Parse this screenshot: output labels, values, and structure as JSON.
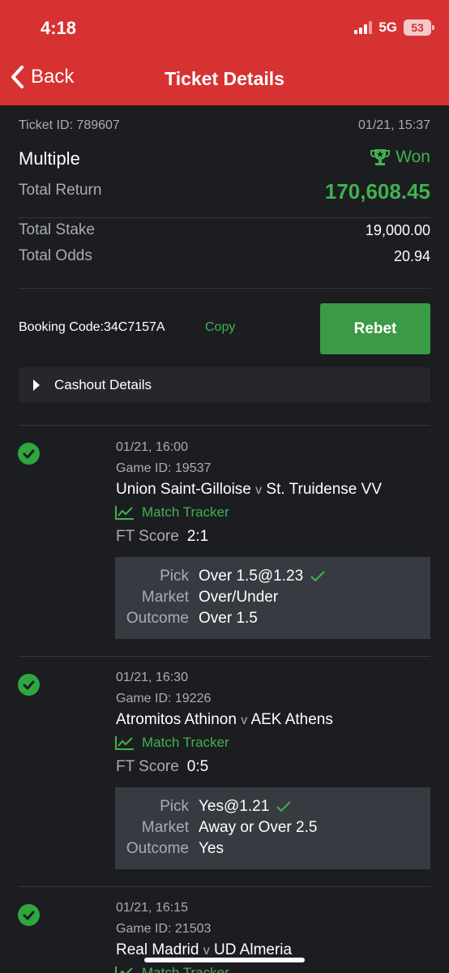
{
  "status_bar": {
    "time": "4:18",
    "network": "5G",
    "battery": "53"
  },
  "nav": {
    "back_label": "Back",
    "title": "Ticket Details"
  },
  "ticket": {
    "id_text": "Ticket ID: 789607",
    "datetime": "01/21, 15:37",
    "type": "Multiple",
    "status": "Won",
    "total_return_label": "Total Return",
    "total_return": "170,608.45",
    "total_stake_label": "Total Stake",
    "total_stake": "19,000.00",
    "total_odds_label": "Total Odds",
    "total_odds": "20.94",
    "booking_code_text": "Booking Code:34C7157A",
    "copy_label": "Copy",
    "rebet_label": "Rebet",
    "cashout_label": "Cashout Details"
  },
  "colors": {
    "header": "#d73232",
    "accent_green": "#3fb24e",
    "background": "#1c1d21"
  },
  "games": [
    {
      "date": "01/21, 16:00",
      "game_id": "Game ID: 19537",
      "home": "Union Saint-Gilloise",
      "vs": "v",
      "away": "St. Truidense VV",
      "tracker_label": "Match Tracker",
      "ft_label": "FT Score",
      "ft_score": "2:1",
      "pick_label": "Pick",
      "pick": "Over 1.5@1.23",
      "market_label": "Market",
      "market": "Over/Under",
      "outcome_label": "Outcome",
      "outcome": "Over 1.5"
    },
    {
      "date": "01/21, 16:30",
      "game_id": "Game ID: 19226",
      "home": "Atromitos Athinon",
      "vs": "v",
      "away": "AEK Athens",
      "tracker_label": "Match Tracker",
      "ft_label": "FT Score",
      "ft_score": "0:5",
      "pick_label": "Pick",
      "pick": "Yes@1.21",
      "market_label": "Market",
      "market": "Away or Over 2.5",
      "outcome_label": "Outcome",
      "outcome": "Yes"
    },
    {
      "date": "01/21, 16:15",
      "game_id": "Game ID: 21503",
      "home": "Real Madrid",
      "vs": "v",
      "away": "UD Almeria",
      "tracker_label": "Match Tracker"
    }
  ]
}
